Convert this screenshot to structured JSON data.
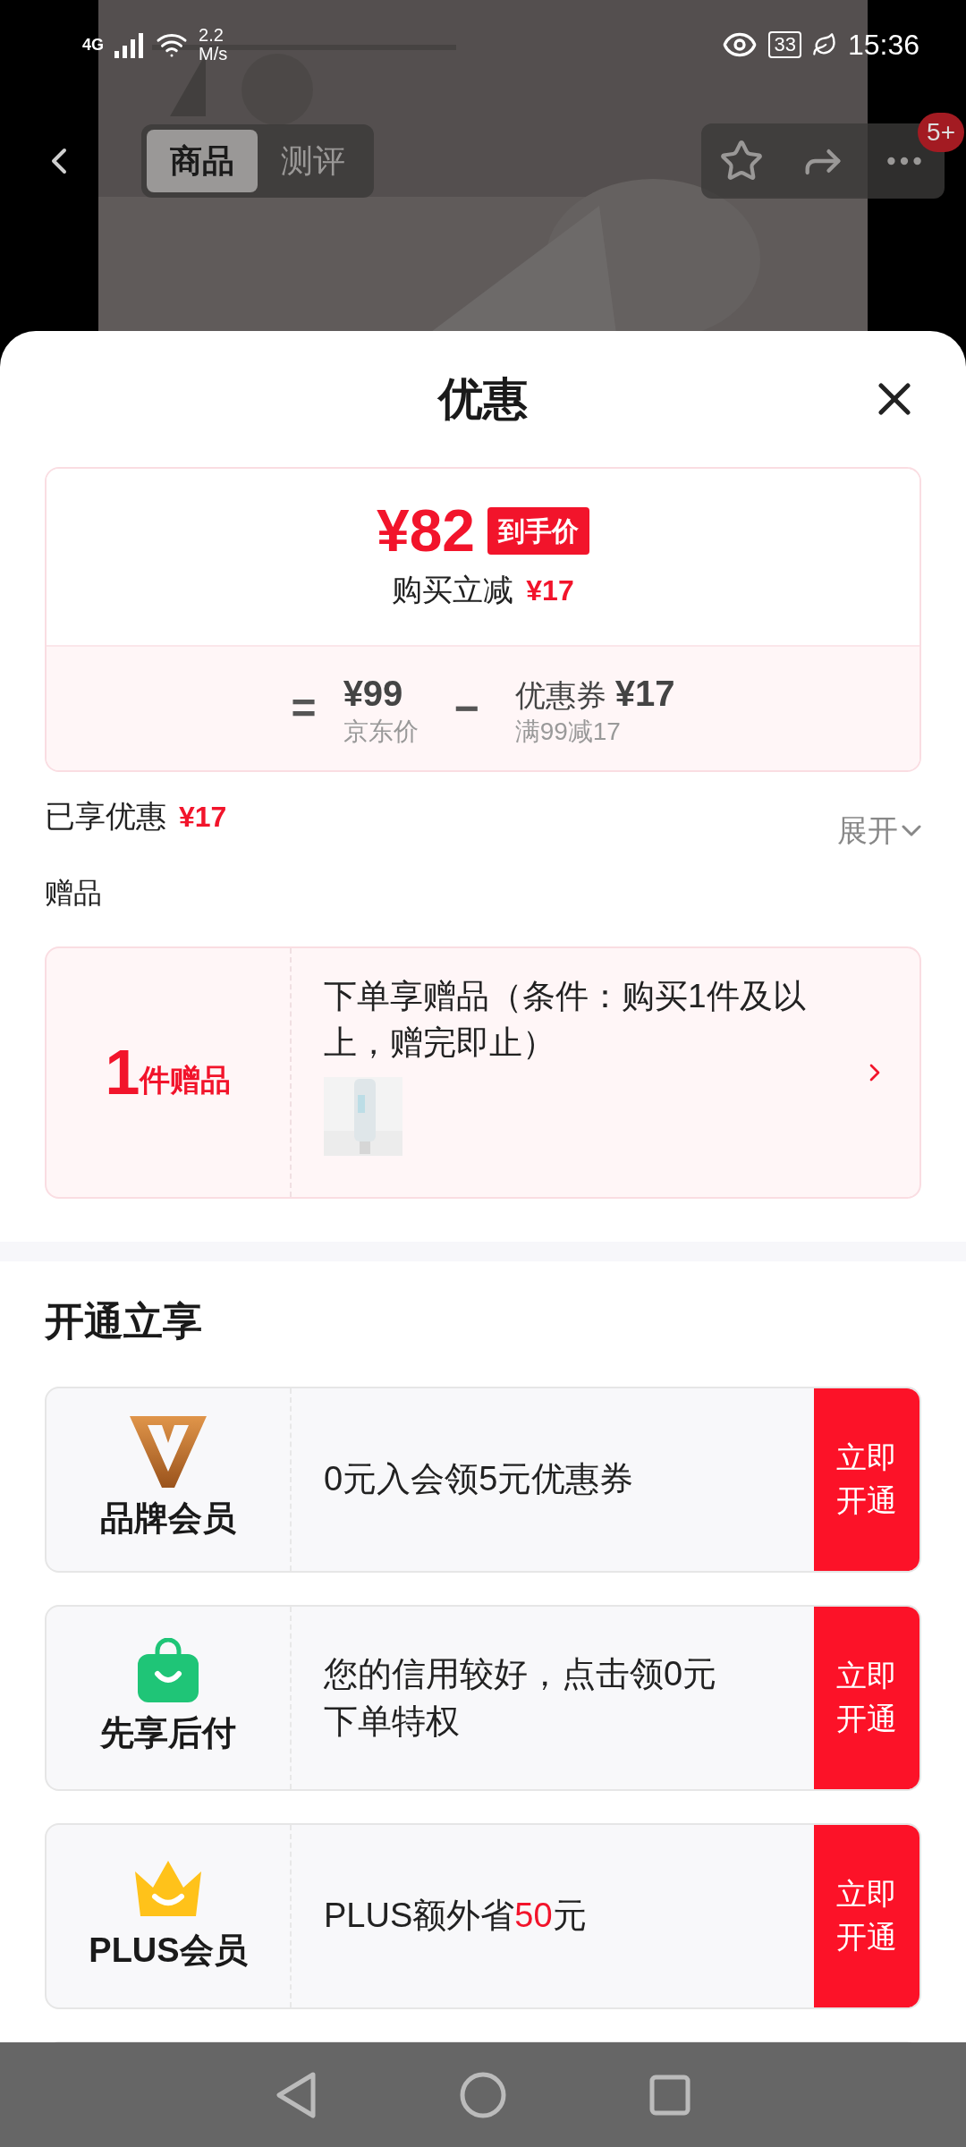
{
  "status_bar": {
    "network": "4G",
    "speed_value": "2.2",
    "speed_unit": "M/s",
    "battery": "33",
    "time": "15:36"
  },
  "header": {
    "tabs": [
      {
        "label": "商品",
        "selected": true
      },
      {
        "label": "测评",
        "selected": false
      }
    ],
    "badge": "5+"
  },
  "sheet": {
    "title": "优惠",
    "price_card": {
      "final_price": "¥82",
      "final_tag": "到手价",
      "saving_label": "购买立减",
      "saving_amount": "¥17",
      "equals": "=",
      "base_price": "¥99",
      "base_label": "京东价",
      "minus": "−",
      "coupon_label": "优惠券",
      "coupon_amount": "¥17",
      "coupon_rule": "满99减17"
    },
    "enjoyed": {
      "label": "已享优惠",
      "amount": "¥17",
      "expand": "展开"
    },
    "gift": {
      "heading": "赠品",
      "count": "1",
      "unit": "件赠品",
      "description": "下单享赠品（条件：购买1件及以上，赠完即止）"
    },
    "membership": {
      "heading": "开通立享",
      "items": [
        {
          "kind": "brand",
          "name": "品牌会员",
          "text": "0元入会领5元优惠券",
          "action": "立即开通"
        },
        {
          "kind": "credit",
          "name": "先享后付",
          "text": "您的信用较好，点击领0元下单特权",
          "action": "立即开通"
        },
        {
          "kind": "plus",
          "name": "PLUS会员",
          "text": "PLUS额外省**50**元",
          "action": "立即开通"
        }
      ]
    }
  }
}
